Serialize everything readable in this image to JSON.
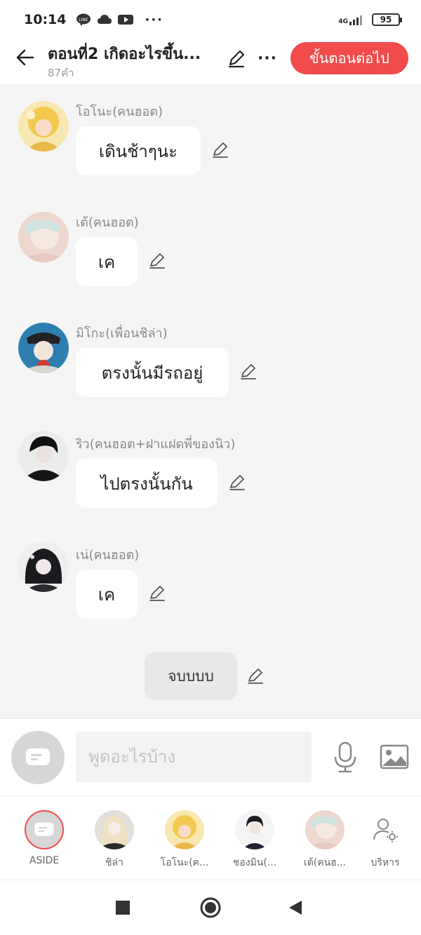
{
  "status": {
    "time": "10:14",
    "network": "4G",
    "battery": "95",
    "notif_icons": [
      "line-icon",
      "cloud-icon",
      "youtube-icon"
    ],
    "more": "···"
  },
  "header": {
    "title": "ตอนที่2 เกิดอะไรขึ้น...",
    "word_count": "87คำ",
    "next_label": "ขั้นตอนต่อไป",
    "more_label": "···"
  },
  "colors": {
    "accent": "#f24b4b",
    "chat_bg": "#f5f5f5",
    "bubble": "#ffffff",
    "end_bubble": "#e8e8e8",
    "sender": "#8a8a8a"
  },
  "messages": [
    {
      "sender": "โอโนะ(คนฮอต)",
      "text": "เดินช้าๆนะ"
    },
    {
      "sender": "เต้(คนฮอต)",
      "text": "เค"
    },
    {
      "sender": "มิโกะ(เพื่อนชิล่า)",
      "text": "ตรงนั้นมีรถอยู่"
    },
    {
      "sender": "ริว(คนฮอต+ฝาแฝดพี่ของนิว)",
      "text": "ไปตรงนั้นกัน"
    },
    {
      "sender": "เน่(คนฮอต)",
      "text": "เค"
    }
  ],
  "end_message": "จบบบบ",
  "input": {
    "placeholder": "พูดอะไรบ้าง"
  },
  "characters": [
    {
      "name": "ASIDE"
    },
    {
      "name": "ชิล่า"
    },
    {
      "name": "โอโนะ(ค..."
    },
    {
      "name": "ชองมิน(..."
    },
    {
      "name": "เต้(คนฮ..."
    },
    {
      "name": "บริหาร"
    }
  ]
}
